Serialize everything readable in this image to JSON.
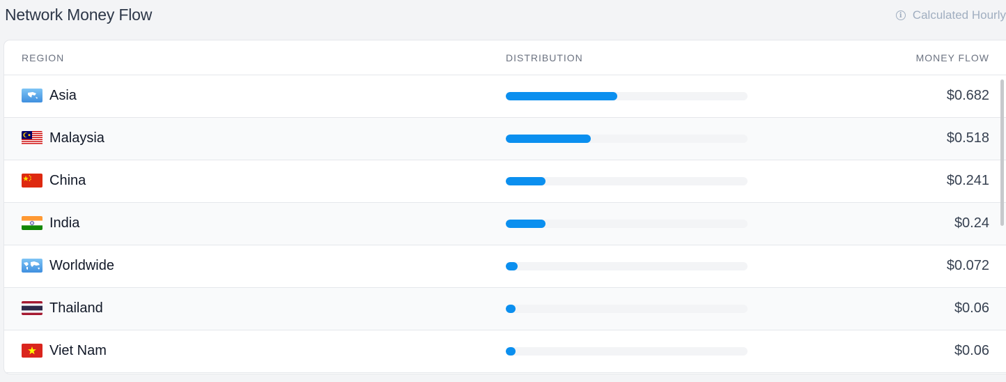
{
  "header": {
    "title": "Network Money Flow",
    "note": "Calculated Hourly",
    "note_icon": "info-icon"
  },
  "table": {
    "columns": {
      "region": "REGION",
      "distribution": "DISTRIBUTION",
      "money_flow": "MONEY FLOW"
    },
    "rows": [
      {
        "name": "Asia",
        "flag": "asia-globe",
        "share": 0.462,
        "amount": "$0.682"
      },
      {
        "name": "Malaysia",
        "flag": "malaysia",
        "share": 0.351,
        "amount": "$0.518"
      },
      {
        "name": "China",
        "flag": "china",
        "share": 0.163,
        "amount": "$0.241"
      },
      {
        "name": "India",
        "flag": "india",
        "share": 0.163,
        "amount": "$0.24"
      },
      {
        "name": "Worldwide",
        "flag": "world-map",
        "share": 0.049,
        "amount": "$0.072"
      },
      {
        "name": "Thailand",
        "flag": "thailand",
        "share": 0.041,
        "amount": "$0.06"
      },
      {
        "name": "Viet Nam",
        "flag": "viet-nam",
        "share": 0.041,
        "amount": "$0.06"
      }
    ]
  },
  "colors": {
    "accent": "#0b8fef",
    "track": "#f3f4f6"
  }
}
